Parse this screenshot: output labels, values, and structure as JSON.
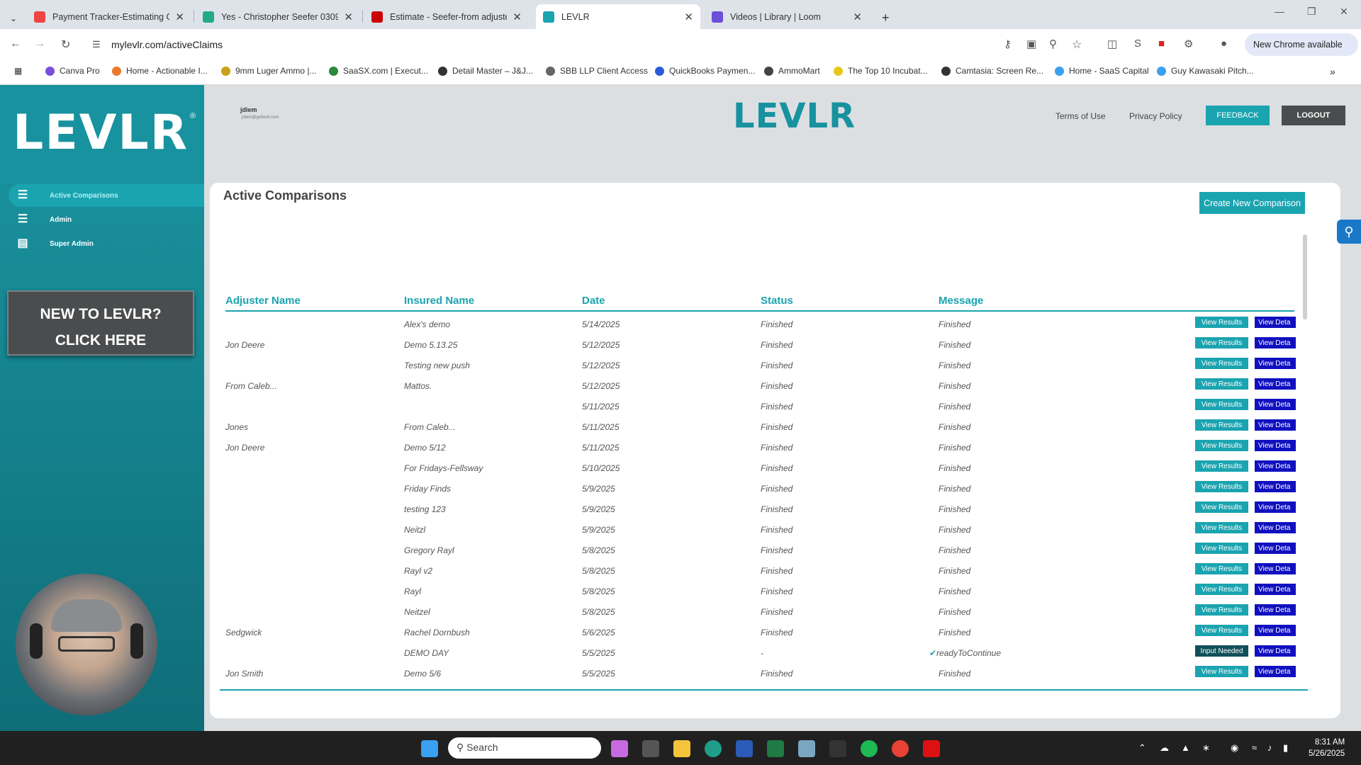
{
  "browser": {
    "tabs": [
      {
        "title": "Payment Tracker-Estimating Or",
        "color": "#e44"
      },
      {
        "title": "Yes - Christopher Seefer 03092",
        "color": "#2a8"
      },
      {
        "title": "Estimate - Seefer-from adjuster",
        "color": "#c00"
      },
      {
        "title": "LEVLR",
        "color": "#1aa4b0"
      },
      {
        "title": "Videos | Library | Loom",
        "color": "#6b4fd8"
      }
    ],
    "url": "mylevlr.com/activeClaims",
    "chrome_badge": "New Chrome available",
    "bookmarks": [
      "Canva Pro",
      "Home - Actionable I...",
      "9mm Luger Ammo |...",
      "SaaSX.com | Execut...",
      "Detail Master – J&J...",
      "SBB LLP Client Access",
      "QuickBooks Paymen...",
      "AmmoMart",
      "The Top 10 Incubat...",
      "Camtasia: Screen Re...",
      "Home - SaaS Capital",
      "Guy Kawasaki Pitch..."
    ]
  },
  "sidebar": {
    "logo": "LEVLR",
    "items": [
      {
        "label": "Active Comparisons",
        "icon": "sliders-icon"
      },
      {
        "label": "Admin",
        "icon": "sliders-icon"
      },
      {
        "label": "Super Admin",
        "icon": "list-icon"
      }
    ],
    "promo_line1": "NEW TO LEVLR?",
    "promo_line2": "CLICK HERE"
  },
  "header": {
    "user": "jdiem",
    "email": "jdiem@getlevlr.com",
    "logo": "LEVLR",
    "terms": "Terms of Use",
    "privacy": "Privacy Policy",
    "feedback": "FEEDBACK",
    "logout": "LOGOUT"
  },
  "main": {
    "title": "Active Comparisons",
    "create_button": "Create New Comparison",
    "columns": [
      "Adjuster Name",
      "Insured Name",
      "Date",
      "Status",
      "Message"
    ],
    "rows": [
      {
        "adjuster": "",
        "insured": "Alex's demo",
        "date": "5/14/2025",
        "status": "Finished",
        "message": "Finished",
        "action": "View Results"
      },
      {
        "adjuster": "Jon Deere",
        "insured": "Demo 5.13.25",
        "date": "5/12/2025",
        "status": "Finished",
        "message": "Finished",
        "action": "View Results"
      },
      {
        "adjuster": "",
        "insured": "Testing new push",
        "date": "5/12/2025",
        "status": "Finished",
        "message": "Finished",
        "action": "View Results"
      },
      {
        "adjuster": "From Caleb...",
        "insured": "Mattos.",
        "date": "5/12/2025",
        "status": "Finished",
        "message": "Finished",
        "action": "View Results"
      },
      {
        "adjuster": "",
        "insured": "",
        "date": "5/11/2025",
        "status": "Finished",
        "message": "Finished",
        "action": "View Results"
      },
      {
        "adjuster": "Jones",
        "insured": "From Caleb...",
        "date": "5/11/2025",
        "status": "Finished",
        "message": "Finished",
        "action": "View Results"
      },
      {
        "adjuster": "Jon Deere",
        "insured": "Demo 5/12",
        "date": "5/11/2025",
        "status": "Finished",
        "message": "Finished",
        "action": "View Results"
      },
      {
        "adjuster": "",
        "insured": "For Fridays-Fellsway",
        "date": "5/10/2025",
        "status": "Finished",
        "message": "Finished",
        "action": "View Results"
      },
      {
        "adjuster": "",
        "insured": "Friday Finds",
        "date": "5/9/2025",
        "status": "Finished",
        "message": "Finished",
        "action": "View Results"
      },
      {
        "adjuster": "",
        "insured": "testing 123",
        "date": "5/9/2025",
        "status": "Finished",
        "message": "Finished",
        "action": "View Results"
      },
      {
        "adjuster": "",
        "insured": "Neitzl",
        "date": "5/9/2025",
        "status": "Finished",
        "message": "Finished",
        "action": "View Results"
      },
      {
        "adjuster": "",
        "insured": "Gregory Rayl",
        "date": "5/8/2025",
        "status": "Finished",
        "message": "Finished",
        "action": "View Results"
      },
      {
        "adjuster": "",
        "insured": "Rayl v2",
        "date": "5/8/2025",
        "status": "Finished",
        "message": "Finished",
        "action": "View Results"
      },
      {
        "adjuster": "",
        "insured": "Rayl",
        "date": "5/8/2025",
        "status": "Finished",
        "message": "Finished",
        "action": "View Results"
      },
      {
        "adjuster": "",
        "insured": "Neitzel",
        "date": "5/8/2025",
        "status": "Finished",
        "message": "Finished",
        "action": "View Results"
      },
      {
        "adjuster": "Sedgwick",
        "insured": "Rachel Dornbush",
        "date": "5/6/2025",
        "status": "Finished",
        "message": "Finished",
        "action": "View Results"
      },
      {
        "adjuster": "",
        "insured": "DEMO DAY",
        "date": "5/5/2025",
        "status": "-",
        "message": "readyToContinue",
        "action": "Input Needed"
      },
      {
        "adjuster": "Jon Smith",
        "insured": "Demo 5/6",
        "date": "5/5/2025",
        "status": "Finished",
        "message": "Finished",
        "action": "View Results"
      }
    ],
    "details_label": "View Deta"
  },
  "taskbar": {
    "search": "Search",
    "time": "8:31 AM",
    "date": "5/26/2025"
  }
}
